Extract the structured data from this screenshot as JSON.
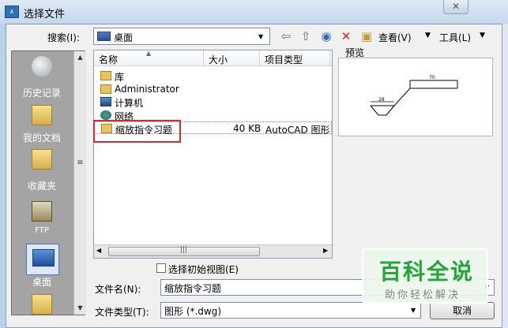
{
  "window": {
    "title": "选择文件",
    "close_glyph": "✕",
    "app_icon_text": "A"
  },
  "toolbar": {
    "search_label": "搜索(I):",
    "location": "桌面",
    "view_label": "查看(V)",
    "tools_label": "工具(L)",
    "icons": [
      "back-icon",
      "up-folder-icon",
      "search-web-icon",
      "delete-icon",
      "new-folder-icon"
    ]
  },
  "places": [
    "历史记录",
    "我的文档",
    "收藏夹",
    "FTP",
    "桌面"
  ],
  "list": {
    "columns": [
      "名称",
      "大小",
      "项目类型"
    ],
    "rows": [
      {
        "name": "库",
        "size": "",
        "type": "",
        "icon": "library-icon"
      },
      {
        "name": "Administrator",
        "size": "",
        "type": "",
        "icon": "user-folder-icon"
      },
      {
        "name": "计算机",
        "size": "",
        "type": "",
        "icon": "computer-icon"
      },
      {
        "name": "网络",
        "size": "",
        "type": "",
        "icon": "network-icon"
      },
      {
        "name": "缩放指令习题",
        "size": "40 KB",
        "type": "AutoCAD 图形",
        "icon": "dwg-file-icon"
      }
    ]
  },
  "preview": {
    "label": "预览",
    "dim_top": "70",
    "dim_left": "28"
  },
  "options": {
    "initial_view_label": "选择初始视图(E)",
    "initial_view_checked": false
  },
  "form": {
    "filename_label": "文件名(N):",
    "filename_value": "缩放指令习题",
    "filetype_label": "文件类型(T):",
    "filetype_value": "图形 (*.dwg)",
    "cancel_label": "取消"
  },
  "watermark": {
    "title": "百科全说",
    "subtitle": "助你轻松解决"
  },
  "colors": {
    "highlight": "#d42c2c",
    "watermark_green": "#26a33a"
  }
}
